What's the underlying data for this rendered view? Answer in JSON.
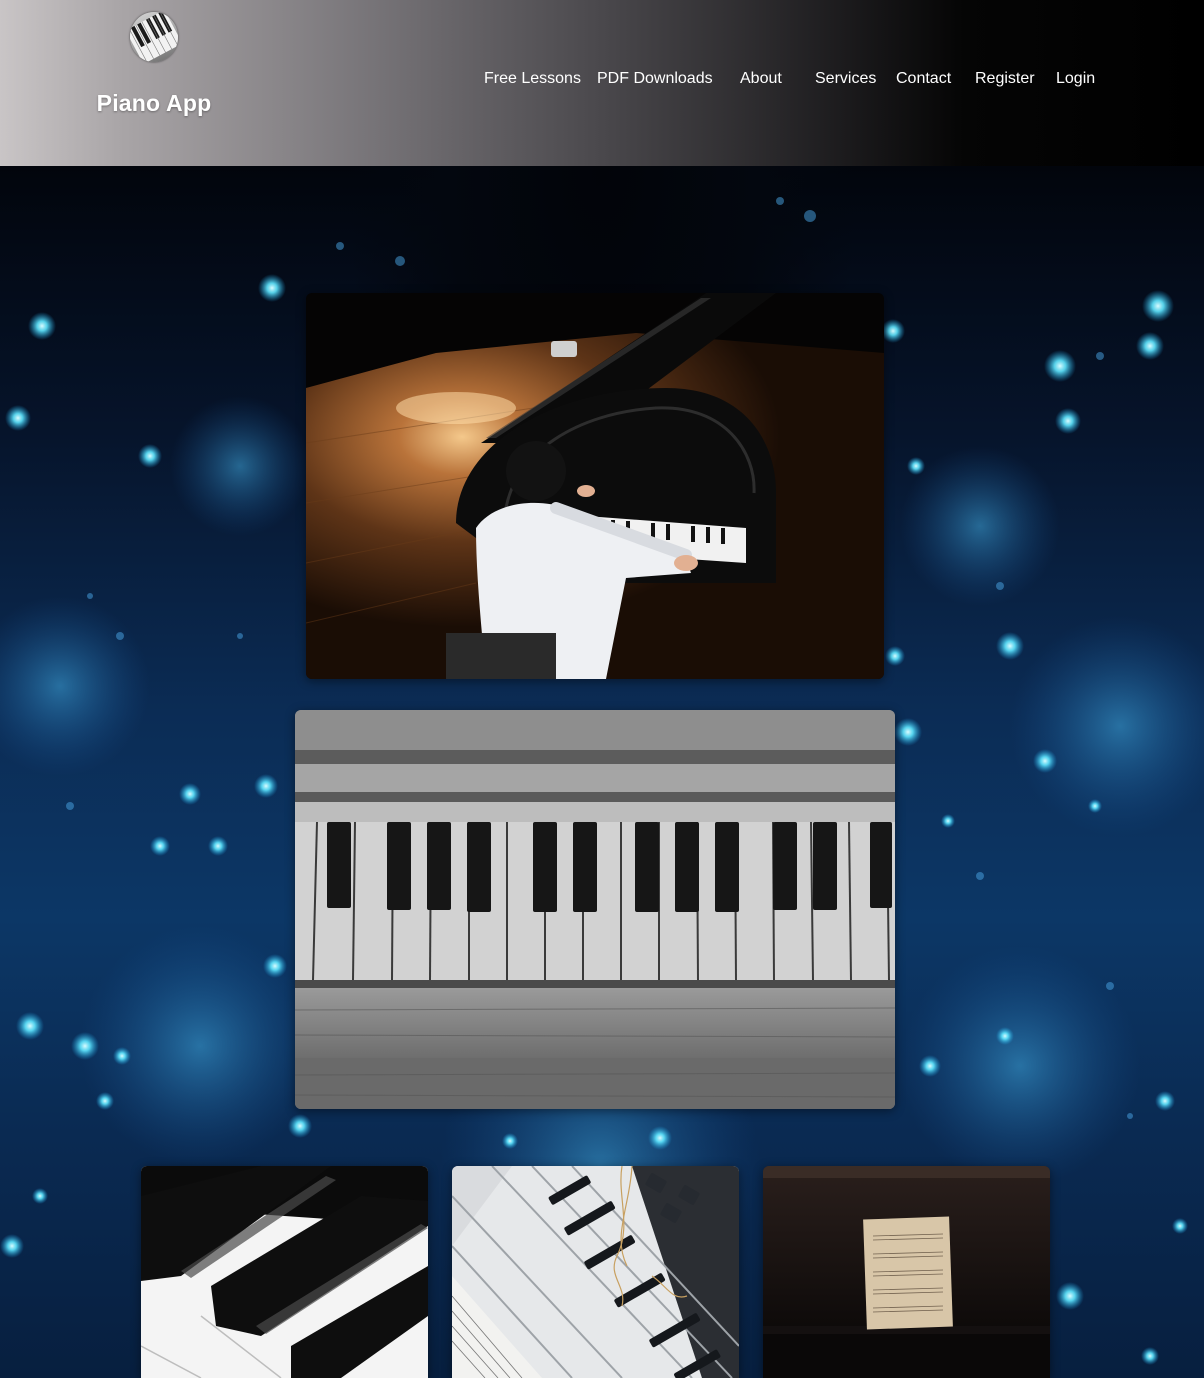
{
  "brand": {
    "title": "Piano App",
    "logo_icon": "piano-keys-logo-icon"
  },
  "nav": {
    "items": [
      {
        "label": "Free Lessons"
      },
      {
        "label": "PDF Downloads"
      },
      {
        "label": "About"
      },
      {
        "label": "Services"
      },
      {
        "label": "Contact"
      },
      {
        "label": "Register"
      },
      {
        "label": "Login"
      }
    ]
  },
  "hero": {
    "background": "blue-bokeh-light-streaks",
    "photos": [
      {
        "subject": "boy playing grand piano on stage"
      },
      {
        "subject": "old black and white piano keyboard"
      },
      {
        "subject": "close-up of black piano keys"
      },
      {
        "subject": "keyboard with sheet music"
      },
      {
        "subject": "sheet music on dark upright piano"
      }
    ]
  },
  "colors": {
    "header_gradient_start": "#c9c5c6",
    "header_gradient_end": "#000000",
    "nav_text": "#ffffff",
    "hero_glow": "#5fe6ff",
    "hero_base": "#0b2c55"
  }
}
